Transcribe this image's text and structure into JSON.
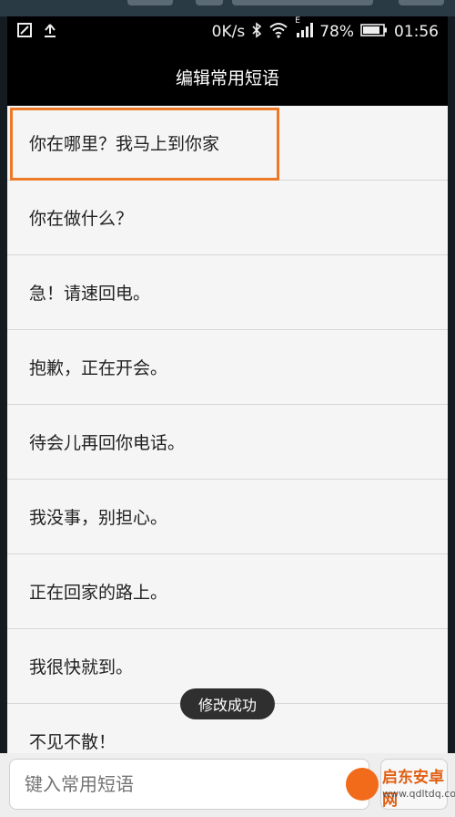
{
  "statusbar": {
    "speed": "0K/s",
    "signal_label": "E",
    "battery": "78%",
    "time": "01:56"
  },
  "header": {
    "title": "编辑常用短语"
  },
  "phrases": [
    "你在哪里？我马上到你家",
    "你在做什么？",
    "急！请速回电。",
    "抱歉，正在开会。",
    "待会儿再回你电话。",
    "我没事，别担心。",
    "正在回家的路上。",
    "我很快就到。",
    "不见不散！"
  ],
  "toast": {
    "text": "修改成功"
  },
  "input": {
    "placeholder": "键入常用短语"
  },
  "watermark": {
    "name": "启东安卓网",
    "url": "www.qdltdq.com"
  },
  "colors": {
    "highlight": "#ee7a28",
    "titlebar": "#000000"
  }
}
